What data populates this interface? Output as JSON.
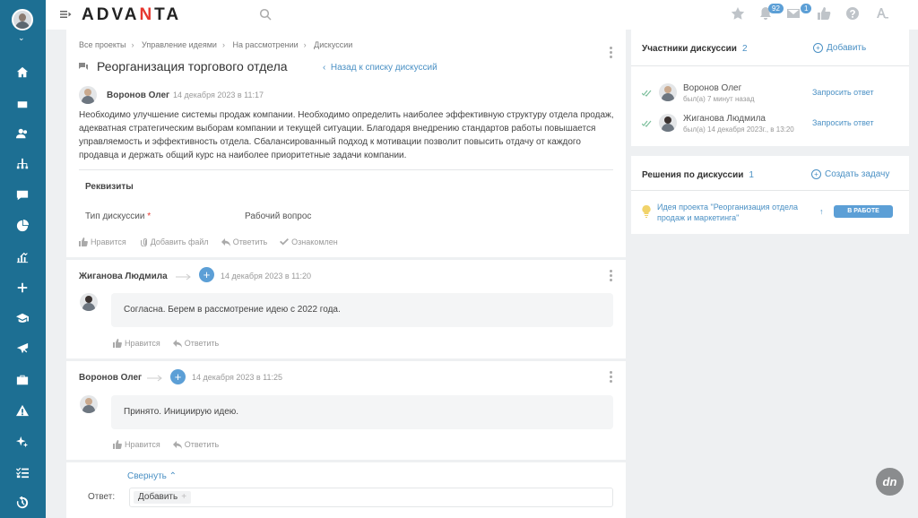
{
  "app": {
    "logo_a": "ADVA",
    "logo_b": "N",
    "logo_c": "TA"
  },
  "topbar": {
    "notif_count": "92",
    "messages_count": "1"
  },
  "breadcrumb": [
    "Все проекты",
    "Управление идеями",
    "На рассмотрении",
    "Дискуссии"
  ],
  "discussion": {
    "title": "Реорганизация торгового отдела",
    "back_link": "Назад к списку дискуссий",
    "author": "Воронов Олег",
    "date": "14 декабря 2023 в 11:17",
    "body": "Необходимо улучшение системы продаж компании. Необходимо определить наиболее эффективную структуру отдела продаж, адекватная стратегическим выборам компании и текущей ситуации. Благодаря внедрению стандартов работы повышается управляемость и эффективность отдела. Сбалансированный подход к мотивации позволит повысить отдачу от каждого продавца и держать общий курс на наиболее приоритетные задачи компании.",
    "section_title": "Реквизиты",
    "field_label": "Тип дискуссии",
    "field_required": "*",
    "field_value": "Рабочий вопрос",
    "actions": {
      "like": "Нравится",
      "attach": "Добавить файл",
      "reply": "Ответить",
      "ack": "Ознакомлен"
    }
  },
  "comments": [
    {
      "author": "Жиганова Людмила",
      "date": "14 декабря 2023 в 11:20",
      "text": "Согласна. Берем в рассмотрение идею с 2022 года.",
      "like": "Нравится",
      "reply": "Ответить"
    },
    {
      "author": "Воронов Олег",
      "date": "14 декабря 2023 в 11:25",
      "text": "Принято. Инициирую идею.",
      "like": "Нравится",
      "reply": "Ответить"
    }
  ],
  "reply_area": {
    "collapse": "Свернуть",
    "label": "Ответ:",
    "add": "Добавить"
  },
  "participants": {
    "title": "Участники дискуссии",
    "count": "2",
    "add": "Добавить",
    "items": [
      {
        "name": "Воронов Олег",
        "status": "был(а) 7 минут назад",
        "request": "Запросить ответ"
      },
      {
        "name": "Жиганова Людмила",
        "status": "был(а) 14 декабря 2023г., в 13:20",
        "request": "Запросить ответ"
      }
    ]
  },
  "decisions": {
    "title": "Решения по дискуссии",
    "count": "1",
    "create": "Создать задачу",
    "task": "Идея проекта \"Реорганизация отдела продаж и маркетинга\"",
    "status": "В РАБОТЕ"
  },
  "colors": {
    "sidebar": "#1d6f93",
    "accent": "#5c9fd6",
    "link": "#4a90c4"
  }
}
